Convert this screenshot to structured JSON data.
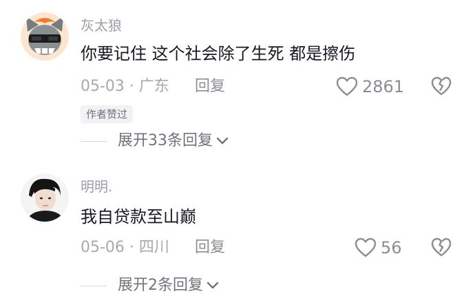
{
  "comments": [
    {
      "username": "灰太狼",
      "text": "你要记住 这个社会除了生死 都是擦伤",
      "date": "05-03",
      "location": "广东",
      "reply_label": "回复",
      "likes": "2861",
      "badge": "作者赞过",
      "expand_label": "展开33条回复",
      "avatar_icon": "cartoon-wolf-avatar"
    },
    {
      "username": "明明.",
      "text": "我自贷款至山巅",
      "date": "05-06",
      "location": "四川",
      "reply_label": "回复",
      "likes": "56",
      "expand_label": "展开2条回复",
      "avatar_icon": "person-photo-avatar"
    }
  ],
  "meta_separator": " · ",
  "colors": {
    "primary_text": "#161823",
    "secondary_text": "#a6a9b0",
    "icon_gray": "#8a8d94"
  }
}
